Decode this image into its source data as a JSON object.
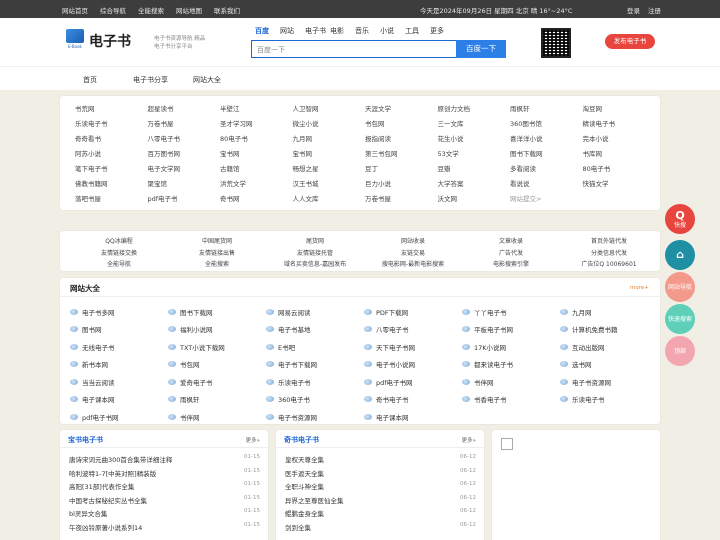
{
  "topbar": {
    "links": [
      "网站首页",
      "综合导航",
      "全能搜索",
      "网站地图",
      "联系我们"
    ],
    "info": "今天是2024年09月26日 星期四 北京 晴 16°~24°C",
    "login": "登录",
    "register": "注册"
  },
  "header": {
    "logo_caption": "E-Book",
    "logo_text": "电子书",
    "slogan": "电子书资源导航 精品电子书分享平台",
    "search_tabs": [
      "百度",
      "网站",
      "电子书",
      "电影",
      "音乐",
      "小说",
      "工具",
      "更多"
    ],
    "search_placeholder": "百度一下",
    "search_button": "百度一下",
    "publish_button": "发布电子书"
  },
  "nav": [
    "首页",
    "电子书分享",
    "网站大全"
  ],
  "links_grid": [
    "书荒网",
    "超星读书",
    "半壁江",
    "人卫智网",
    "天涯文学",
    "原创力文档",
    "雨枫轩",
    "淘豆网",
    "乐读电子书",
    "万卷书屋",
    "圣才学习网",
    "微尘小说",
    "书包网",
    "三一文库",
    "360图书馆",
    "精读电子书",
    "奇奇看书",
    "八零电子书",
    "80电子书",
    "九月网",
    "报指阅读",
    "花生小说",
    "喜洋洋小说",
    "完本小说",
    "阿苏小说",
    "百万图书网",
    "宝书网",
    "宝书网",
    "第三书包网",
    "53文学",
    "图书下载网",
    "书库网",
    "笔下电子书",
    "电子文学网",
    "古籍馆",
    "畅想之星",
    "豆丁",
    "豆瓣",
    "多看阅读",
    "80电子书",
    "佛教书籍网",
    "聚宝馆",
    "洪荒文学",
    "汉王书城",
    "巨力小说",
    "大学答案",
    "看说说",
    "快猫文学",
    "落吧书屋",
    "pdf电子书",
    "奇书网",
    "人人文库",
    "万卷书屋",
    "沃文网",
    "网站提交>",
    ""
  ],
  "info_grid": [
    "QQ冰编程",
    "中国尾货网",
    "尾货网",
    "网站收录",
    "文章收录",
    "首页外链代发",
    "友情链接交换",
    "友情链接出售",
    "友情链接托管",
    "友链交易",
    "广告代发",
    "分类信息代发",
    "全能导航",
    "全能搜索",
    "域名买卖信息-嘉园发布",
    "搜电影网-最新电影搜索",
    "电影搜索引擎",
    "广告位Q 10069601"
  ],
  "all_sites": {
    "title": "网站大全",
    "more": "more+",
    "items": [
      "电子书多网",
      "图书下载网",
      "网易云阅读",
      "PDF下载网",
      "丫丫电子书",
      "九月网",
      "图书网",
      "福利小说网",
      "电子书基地",
      "八零电子书",
      "平板电子书网",
      "计算机免费书籍",
      "无线电子书",
      "TXT小说下载网",
      "E书吧",
      "天下电子书网",
      "17K小说网",
      "互动出版网",
      "新书本网",
      "书包网",
      "电子书下载网",
      "电子书小说网",
      "都来读电子书",
      "选书网",
      "当当云阅读",
      "爱奇电子书",
      "乐读电子书",
      "pdf电子书网",
      "书伴网",
      "电子书资源网",
      "电子课本网",
      "雨枫轩",
      "360电子书",
      "奇书电子书",
      "书香电子书",
      "乐读电子书",
      "pdf电子书网",
      "书伴网",
      "电子书资源网",
      "电子课本网",
      "",
      ""
    ]
  },
  "columns": [
    {
      "title": "宝书电子书",
      "more": "更多»",
      "rows": [
        {
          "t": "唐诗宋词元曲300首合集带详细注释",
          "d": "01-15"
        },
        {
          "t": "哈利波特1-7[中英对照]精装版",
          "d": "01-15"
        },
        {
          "t": "高阳[31部]代表作全集",
          "d": "01-15"
        },
        {
          "t": "中国考古探秘纪实丛书全集",
          "d": "01-15"
        },
        {
          "t": "bl灵异文合集",
          "d": "01-15"
        },
        {
          "t": "午夜凶铃原著小说系列14",
          "d": "01-15"
        }
      ]
    },
    {
      "title": "奇书电子书",
      "more": "更多»",
      "rows": [
        {
          "t": "皇权天尊全集",
          "d": "06-12"
        },
        {
          "t": "医手遮天全集",
          "d": "06-12"
        },
        {
          "t": "全职斗神全集",
          "d": "06-12"
        },
        {
          "t": "异界之至尊医仙全集",
          "d": "06-12"
        },
        {
          "t": "鲲鹏金身全集",
          "d": "06-12"
        },
        {
          "t": "剑到全集",
          "d": "06-12"
        }
      ]
    }
  ],
  "side_buttons": [
    {
      "glyph": "Q",
      "label": "快搜",
      "color": "#e9453f"
    },
    {
      "glyph": "⌂",
      "label": "",
      "color": "#1f8fa3"
    },
    {
      "glyph": "",
      "label": "网站导航",
      "color": "#f39a8c"
    },
    {
      "glyph": "",
      "label": "快速搜索",
      "color": "#5fcfb9"
    },
    {
      "glyph": "",
      "label": "顶部",
      "color": "#f3a6b0"
    }
  ]
}
